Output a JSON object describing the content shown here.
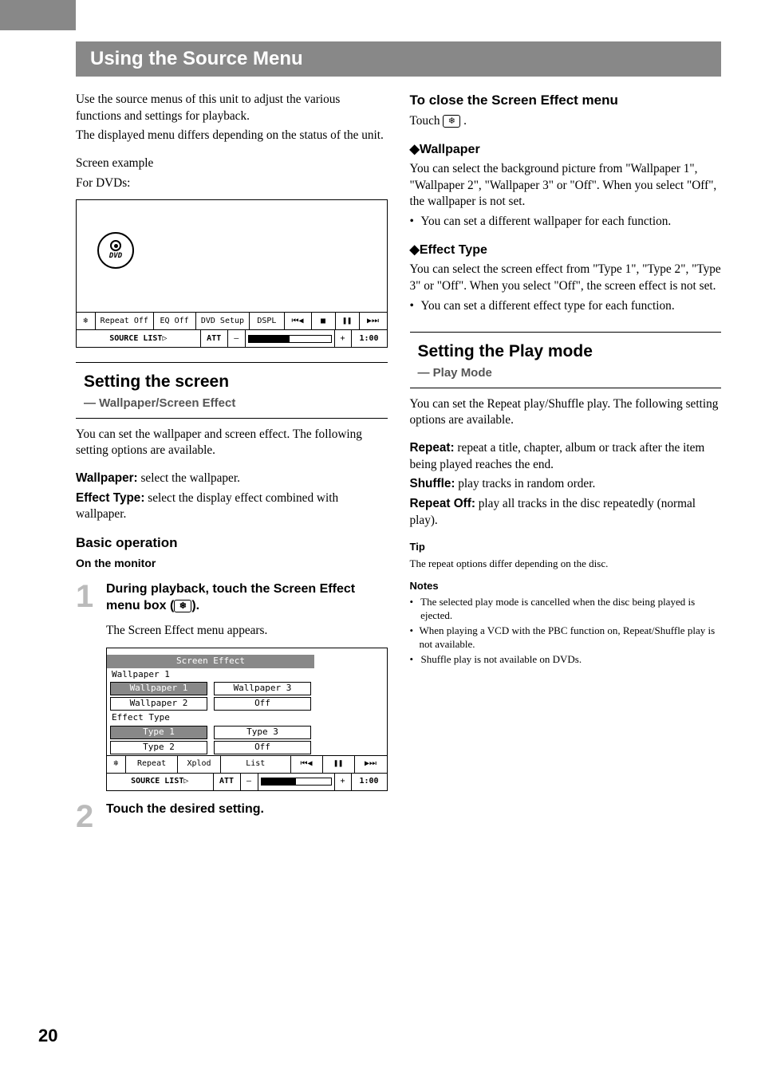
{
  "page_number": "20",
  "title": "Using the Source Menu",
  "left": {
    "intro1": "Use the source menus of this unit to adjust the various functions and settings for playback.",
    "intro2": "The displayed menu differs depending on the status of the unit.",
    "example_label": "Screen example",
    "example_for": "For DVDs:",
    "diag": {
      "dvd": "DVD",
      "row1": [
        "Repeat Off",
        "EQ Off",
        "DVD Setup",
        "DSPL",
        "⏮◀",
        "■",
        "❚❚",
        "▶⏭"
      ],
      "row2_source": "SOURCE LIST▷",
      "row2_att": "ATT",
      "row2_minus": "–",
      "row2_plus": "+",
      "row2_time": "1:00"
    },
    "screenbox": {
      "heading": "Setting the screen",
      "sub": "— Wallpaper/Screen Effect"
    },
    "screen_intro": "You can set the wallpaper and screen effect. The following setting options are available.",
    "wallpaper_label": "Wallpaper:",
    "wallpaper_text": " select the wallpaper.",
    "effect_label": "Effect Type:",
    "effect_text": " select the display effect combined with wallpaper.",
    "basic_op": "Basic operation",
    "on_monitor": "On the monitor",
    "step1_title_a": "During playback, touch the Screen Effect menu box (",
    "step1_title_b": ").",
    "step1_body": "The Screen Effect menu appears.",
    "se": {
      "title": "Screen Effect",
      "wp_label": "Wallpaper 1",
      "wp1": "Wallpaper 1",
      "wp3": "Wallpaper 3",
      "wp2": "Wallpaper 2",
      "wp_off": "Off",
      "et_label": "Effect Type",
      "t1": "Type 1",
      "t3": "Type 3",
      "t2": "Type 2",
      "t_off": "Off",
      "row1": [
        "Repeat",
        "Xplod",
        "List",
        "⏮◀",
        "❚❚",
        "▶⏭"
      ],
      "row2_source": "SOURCE LIST▷",
      "row2_att": "ATT",
      "row2_time": "1:00"
    },
    "step2_title": "Touch the desired setting."
  },
  "right": {
    "close_head": "To close the Screen Effect menu",
    "close_body_a": "Touch ",
    "close_body_b": " .",
    "wp_head": "Wallpaper",
    "wp_body": "You can select the background picture from \"Wallpaper 1\", \"Wallpaper 2\", \"Wallpaper 3\" or \"Off\". When you select \"Off\", the wallpaper is not set.",
    "wp_bullet": "You can set a different wallpaper for each function.",
    "et_head": "Effect Type",
    "et_body": "You can select the screen effect from \"Type 1\", \"Type 2\", \"Type 3\" or \"Off\". When you select \"Off\", the screen effect is not set.",
    "et_bullet": "You can set a different effect type for each function.",
    "playbox": {
      "heading": "Setting the Play mode",
      "sub": "— Play Mode"
    },
    "play_intro": "You can set the Repeat play/Shuffle play. The following setting options are available.",
    "repeat_label": "Repeat:",
    "repeat_text": " repeat a title, chapter, album or track after the item being played reaches the end.",
    "shuffle_label": "Shuffle:",
    "shuffle_text": " play tracks in random order.",
    "roff_label": "Repeat Off:",
    "roff_text": " play all tracks in the disc repeatedly (normal play).",
    "tip_head": "Tip",
    "tip_body": "The repeat options differ depending on the disc.",
    "notes_head": "Notes",
    "notes": [
      "The selected play mode is cancelled when the disc being played is ejected.",
      "When playing a VCD with the PBC function on, Repeat/Shuffle play is not available.",
      "Shuffle play is not available on DVDs."
    ]
  }
}
